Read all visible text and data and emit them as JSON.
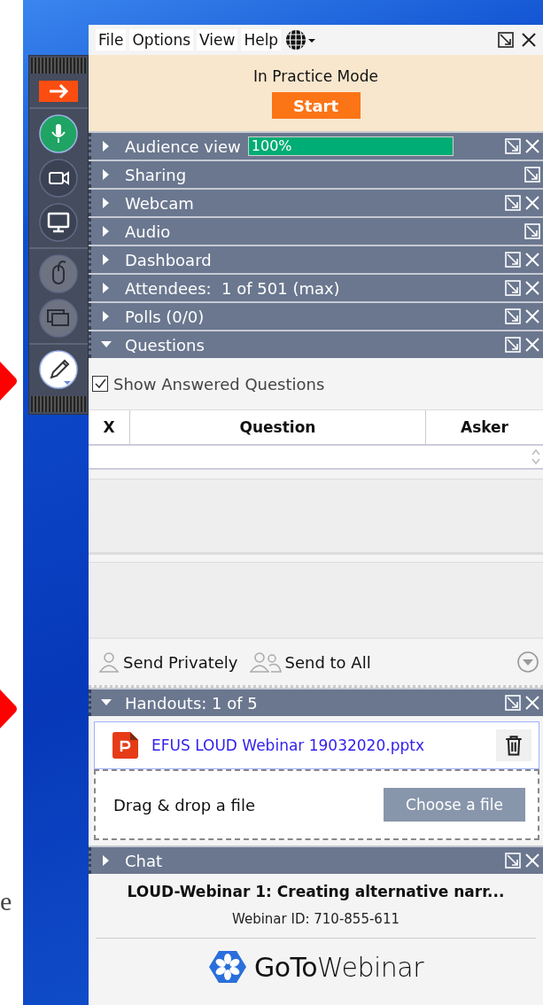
{
  "margin_text": "e",
  "toolbar": {
    "groups": [
      [
        {
          "kind": "arrow",
          "on": true,
          "disabled": false
        }
      ],
      [
        {
          "kind": "mic",
          "on": true,
          "disabled": false
        },
        {
          "kind": "camera",
          "on": false,
          "disabled": false
        },
        {
          "kind": "screen",
          "on": false,
          "disabled": false
        }
      ],
      [
        {
          "kind": "mouse",
          "on": false,
          "disabled": true
        },
        {
          "kind": "screens",
          "on": false,
          "disabled": true
        }
      ],
      [
        {
          "kind": "pencil",
          "on": true,
          "disabled": false
        }
      ]
    ]
  },
  "menu": [
    "File",
    "Options",
    "View",
    "Help"
  ],
  "practice": {
    "status": "In Practice Mode",
    "button": "Start"
  },
  "sections": [
    {
      "kind": "plain",
      "title": "Audience view",
      "expanded": false,
      "closable": true,
      "progress": {
        "level": 1,
        "text": "100%"
      }
    },
    {
      "kind": "plain",
      "title": "Sharing",
      "expanded": false,
      "closable": false
    },
    {
      "kind": "plain",
      "title": "Webcam",
      "expanded": false,
      "closable": true
    },
    {
      "kind": "plain",
      "title": "Audio",
      "expanded": false,
      "closable": false
    },
    {
      "kind": "plain",
      "title": "Dashboard",
      "expanded": false,
      "closable": true
    },
    {
      "kind": "plain",
      "title": "Attendees:  1 of 501 (max)",
      "expanded": false,
      "closable": true
    },
    {
      "kind": "plain",
      "title": "Polls (0/0)",
      "expanded": false,
      "closable": true
    },
    {
      "kind": "questions",
      "title": "Questions",
      "expanded": true,
      "closable": true,
      "show_answered": {
        "label": "Show Answered Questions",
        "checked": true
      },
      "columns": [
        "X",
        "Question",
        "Asker"
      ],
      "send": [
        "Send Privately",
        "Send to All"
      ]
    },
    {
      "kind": "handouts",
      "title": "Handouts: 1 of 5",
      "expanded": true,
      "closable": true,
      "file": "EFUS LOUD Webinar 19032020.pptx",
      "drop_text": "Drag & drop a file",
      "choose_button": "Choose a file"
    },
    {
      "kind": "plain",
      "title": "Chat",
      "expanded": false,
      "closable": true
    }
  ],
  "footer": {
    "title": "LOUD-Webinar 1: Creating alternative narr...",
    "webinar_id": "Webinar ID: 710-855-611",
    "logo": "**GoTo**Webinar"
  }
}
